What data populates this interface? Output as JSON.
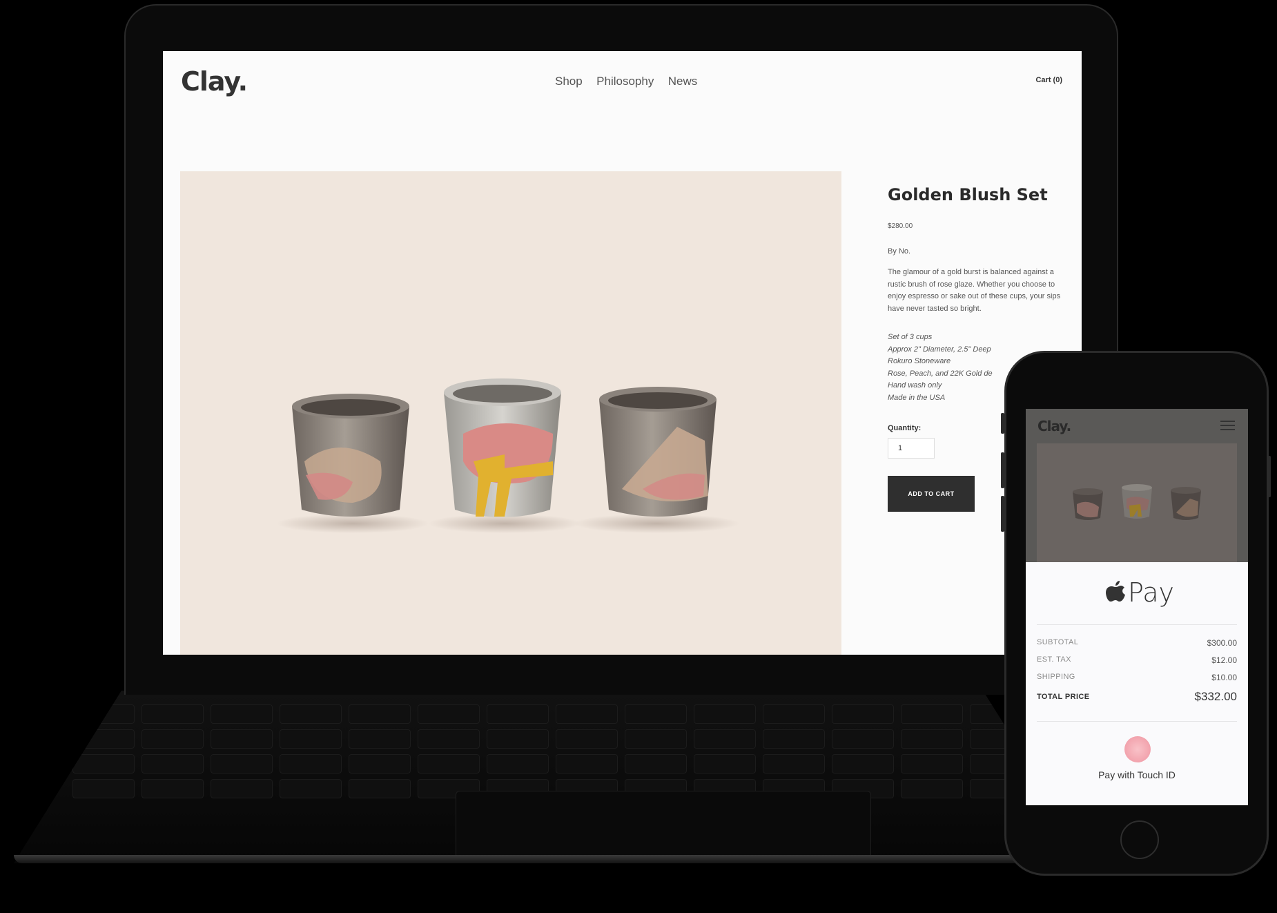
{
  "laptop": {
    "header": {
      "logo": "Clay.",
      "nav": [
        "Shop",
        "Philosophy",
        "News"
      ],
      "cart": "Cart (0)"
    },
    "product": {
      "title": "Golden Blush Set",
      "price": "$280.00",
      "byline": "By No.",
      "description": "The glamour of a gold burst is balanced against a rustic brush of rose glaze. Whether you choose to enjoy espresso or sake out of these cups, your sips have never tasted so bright.",
      "details": [
        "Set of 3 cups",
        "Approx 2\" Diameter, 2.5\" Deep",
        "Rokuro Stoneware",
        "Rose, Peach, and 22K Gold de",
        "Hand wash only",
        "Made in the USA"
      ],
      "quantity_label": "Quantity:",
      "quantity_value": "1",
      "add_to_cart": "ADD TO CART"
    }
  },
  "phone": {
    "logo": "Clay.",
    "pay_label": "Pay",
    "rows": [
      {
        "label": "SUBTOTAL",
        "value": "$300.00"
      },
      {
        "label": "EST. TAX",
        "value": "$12.00"
      },
      {
        "label": "SHIPPING",
        "value": "$10.00"
      }
    ],
    "total_label": "TOTAL PRICE",
    "total_value": "$332.00",
    "touch_id_label": "Pay with Touch ID"
  },
  "colors": {
    "background": "#000000",
    "button": "#2f2f2f",
    "product_bg": "#f0e6dd",
    "touch_id": "#f2a3ad"
  }
}
